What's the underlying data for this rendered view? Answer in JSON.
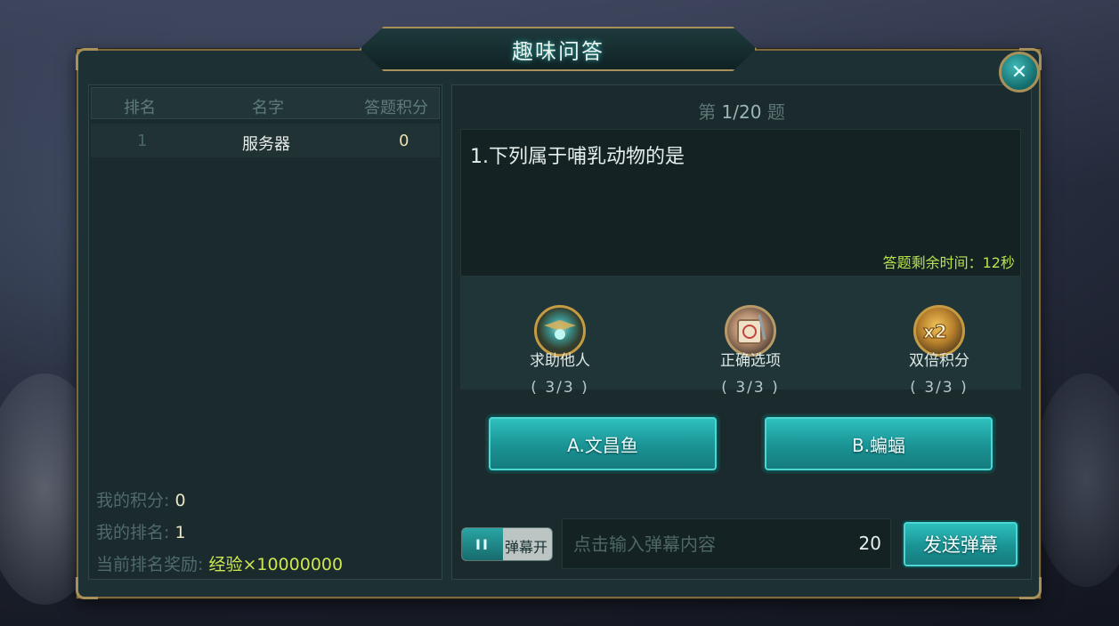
{
  "dialog": {
    "title": "趣味问答",
    "close_symbol": "✕"
  },
  "ranking": {
    "headers": [
      "排名",
      "名字",
      "答题积分"
    ],
    "rows": [
      {
        "rank": "1",
        "name": "服务器",
        "score": "0"
      }
    ],
    "my_score_label": "我的积分:",
    "my_score": "0",
    "my_rank_label": "我的排名:",
    "my_rank": "1",
    "reward_label": "当前排名奖励:",
    "reward": "经验×10000000"
  },
  "question": {
    "prefix": "第",
    "progress": "1/20",
    "suffix": "题",
    "text": "1.下列属于哺乳动物的是",
    "time_remaining": "答题剩余时间：12秒"
  },
  "tools": [
    {
      "name": "求助他人",
      "count": "( 3/3 )",
      "icon": "help-others-icon"
    },
    {
      "name": "正确选项",
      "count": "( 3/3 )",
      "icon": "correct-option-scroll-icon"
    },
    {
      "name": "双倍积分",
      "count": "( 3/3 )",
      "icon": "double-score-x2-icon"
    }
  ],
  "answers": [
    {
      "label": "A.文昌鱼"
    },
    {
      "label": "B.蝙蝠"
    }
  ],
  "danmu": {
    "toggle_icon": "II",
    "toggle_label": "弹幕开",
    "placeholder": "点击输入弹幕内容",
    "char_limit": "20",
    "send_label": "发送弹幕"
  },
  "colors": {
    "panel_bg": "#1d3134",
    "gold_border": "#a8905a",
    "button_teal": "#1a9294",
    "highlight_green": "#cde651"
  }
}
